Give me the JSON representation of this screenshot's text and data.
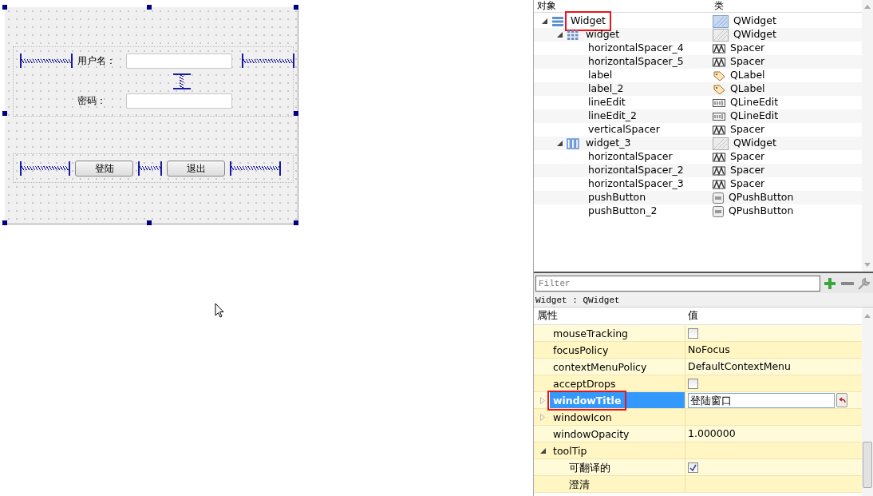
{
  "form": {
    "username_label": "用户名：",
    "password_label": "密码：",
    "buttons": [
      {
        "label": "登陆"
      },
      {
        "label": "退出"
      }
    ]
  },
  "object_inspector": {
    "columns": [
      "对象",
      "类"
    ],
    "tree": [
      {
        "name": "Widget",
        "class": "QWidget",
        "kind": "widget",
        "expanded": true,
        "marked": true,
        "children": [
          {
            "name": "widget",
            "class": "QWidget",
            "kind": "grid",
            "expanded": true,
            "marked": false,
            "children": [
              {
                "name": "horizontalSpacer_4",
                "class": "Spacer",
                "kind": "spacer",
                "marked": false
              },
              {
                "name": "horizontalSpacer_5",
                "class": "Spacer",
                "kind": "spacer",
                "marked": false
              },
              {
                "name": "label",
                "class": "QLabel",
                "kind": "label",
                "marked": false
              },
              {
                "name": "label_2",
                "class": "QLabel",
                "kind": "label",
                "marked": false
              },
              {
                "name": "lineEdit",
                "class": "QLineEdit",
                "kind": "lineedit",
                "marked": false
              },
              {
                "name": "lineEdit_2",
                "class": "QLineEdit",
                "kind": "lineedit",
                "marked": false
              },
              {
                "name": "verticalSpacer",
                "class": "Spacer",
                "kind": "spacer",
                "marked": false
              }
            ]
          },
          {
            "name": "widget_3",
            "class": "QWidget",
            "kind": "hbox",
            "expanded": true,
            "marked": false,
            "children": [
              {
                "name": "horizontalSpacer",
                "class": "Spacer",
                "kind": "spacer",
                "marked": false
              },
              {
                "name": "horizontalSpacer_2",
                "class": "Spacer",
                "kind": "spacer",
                "marked": false
              },
              {
                "name": "horizontalSpacer_3",
                "class": "Spacer",
                "kind": "spacer",
                "marked": false
              },
              {
                "name": "pushButton",
                "class": "QPushButton",
                "kind": "button",
                "marked": false
              },
              {
                "name": "pushButton_2",
                "class": "QPushButton",
                "kind": "button",
                "marked": false
              }
            ]
          }
        ]
      }
    ]
  },
  "property_editor": {
    "filter": {
      "placeholder": "Filter"
    },
    "object_label": "Widget : QWidget",
    "columns": [
      "属性",
      "值"
    ],
    "properties": [
      {
        "name": "mouseTracking",
        "kind": "checkbox",
        "checked": false,
        "selected": false,
        "marked": false
      },
      {
        "name": "focusPolicy",
        "kind": "text",
        "value": "NoFocus",
        "selected": false,
        "marked": false
      },
      {
        "name": "contextMenuPolicy",
        "kind": "text",
        "value": "DefaultContextMenu",
        "selected": false,
        "marked": false
      },
      {
        "name": "acceptDrops",
        "kind": "checkbox",
        "checked": false,
        "selected": false,
        "marked": false
      },
      {
        "name": "windowTitle",
        "kind": "editing",
        "value": "登陆窗口",
        "selected": true,
        "marked": true,
        "expanded": false
      },
      {
        "name": "windowIcon",
        "kind": "text",
        "selected": false,
        "marked": false,
        "expanded": false
      },
      {
        "name": "windowOpacity",
        "kind": "text",
        "value": "1.000000",
        "selected": false,
        "marked": false
      },
      {
        "name": "toolTip",
        "kind": "text",
        "selected": false,
        "marked": false,
        "expanded": true,
        "children": [
          {
            "name": "可翻译的",
            "kind": "checkbox",
            "checked": true,
            "selected": false,
            "marked": false
          },
          {
            "name": "澄清",
            "kind": "text",
            "selected": false,
            "marked": false
          }
        ]
      }
    ]
  }
}
